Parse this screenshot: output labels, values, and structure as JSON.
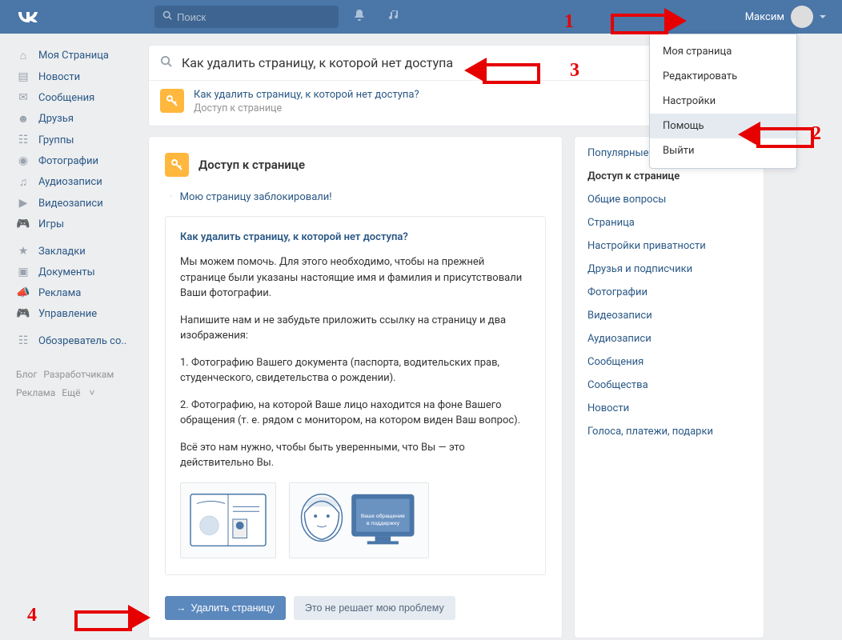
{
  "header": {
    "search_placeholder": "Поиск",
    "username": "Максим"
  },
  "sidebar": {
    "items": [
      {
        "label": "Моя Страница"
      },
      {
        "label": "Новости"
      },
      {
        "label": "Сообщения"
      },
      {
        "label": "Друзья"
      },
      {
        "label": "Группы"
      },
      {
        "label": "Фотографии"
      },
      {
        "label": "Аудиозаписи"
      },
      {
        "label": "Видеозаписи"
      },
      {
        "label": "Игры"
      }
    ],
    "items2": [
      {
        "label": "Закладки"
      },
      {
        "label": "Документы"
      },
      {
        "label": "Реклама"
      },
      {
        "label": "Управление"
      }
    ],
    "items3": [
      {
        "label": "Обозреватель со.."
      }
    ],
    "footer": {
      "blog": "Блог",
      "dev": "Разработчикам",
      "ads": "Реклама",
      "more": "Ещё"
    }
  },
  "search": {
    "query": "Как удалить страницу, к которой нет доступа",
    "result_title": "Как удалить страницу, к которой нет доступа?",
    "result_sub": "Доступ к странице"
  },
  "article": {
    "heading": "Доступ к странице",
    "blocked_link": "Мою страницу заблокировали!",
    "title": "Как удалить страницу, к которой нет доступа?",
    "p1": "Мы можем помочь. Для этого необходимо, чтобы на прежней странице были указаны настоящие имя и фамилия и присутствовали Ваши фотографии.",
    "p2": "Напишите нам и не забудьте приложить ссылку на страницу и два изображения:",
    "p3": "1. Фотографию Вашего документа (паспорта, водительских прав, студенческого, свидетельства о рождении).",
    "p4": "2. Фотографию, на которой Ваше лицо находится на фоне Вашего обращения (т. е. рядом с монитором, на котором виден Ваш вопрос).",
    "p5": "Всё это нам нужно, чтобы быть уверенными, что Вы — это действительно Вы.",
    "btn_delete": "Удалить страницу",
    "btn_nohelp": "Это не решает мою проблему"
  },
  "rightnav": {
    "items": [
      {
        "label": "Популярные",
        "active": false
      },
      {
        "label": "Доступ к странице",
        "active": true
      },
      {
        "label": "Общие вопросы",
        "active": false
      },
      {
        "label": "Страница",
        "active": false
      },
      {
        "label": "Настройки приватности",
        "active": false
      },
      {
        "label": "Друзья и подписчики",
        "active": false
      },
      {
        "label": "Фотографии",
        "active": false
      },
      {
        "label": "Видеозаписи",
        "active": false
      },
      {
        "label": "Аудиозаписи",
        "active": false
      },
      {
        "label": "Сообщения",
        "active": false
      },
      {
        "label": "Сообщества",
        "active": false
      },
      {
        "label": "Новости",
        "active": false
      },
      {
        "label": "Голоса, платежи, подарки",
        "active": false
      }
    ]
  },
  "dropdown": {
    "items": [
      {
        "label": "Моя страница",
        "hl": false
      },
      {
        "label": "Редактировать",
        "hl": false
      },
      {
        "label": "Настройки",
        "hl": false
      },
      {
        "label": "Помощь",
        "hl": true
      },
      {
        "label": "Выйти",
        "hl": false
      }
    ]
  },
  "annotations": {
    "n1": "1",
    "n2": "2",
    "n3": "3",
    "n4": "4"
  }
}
